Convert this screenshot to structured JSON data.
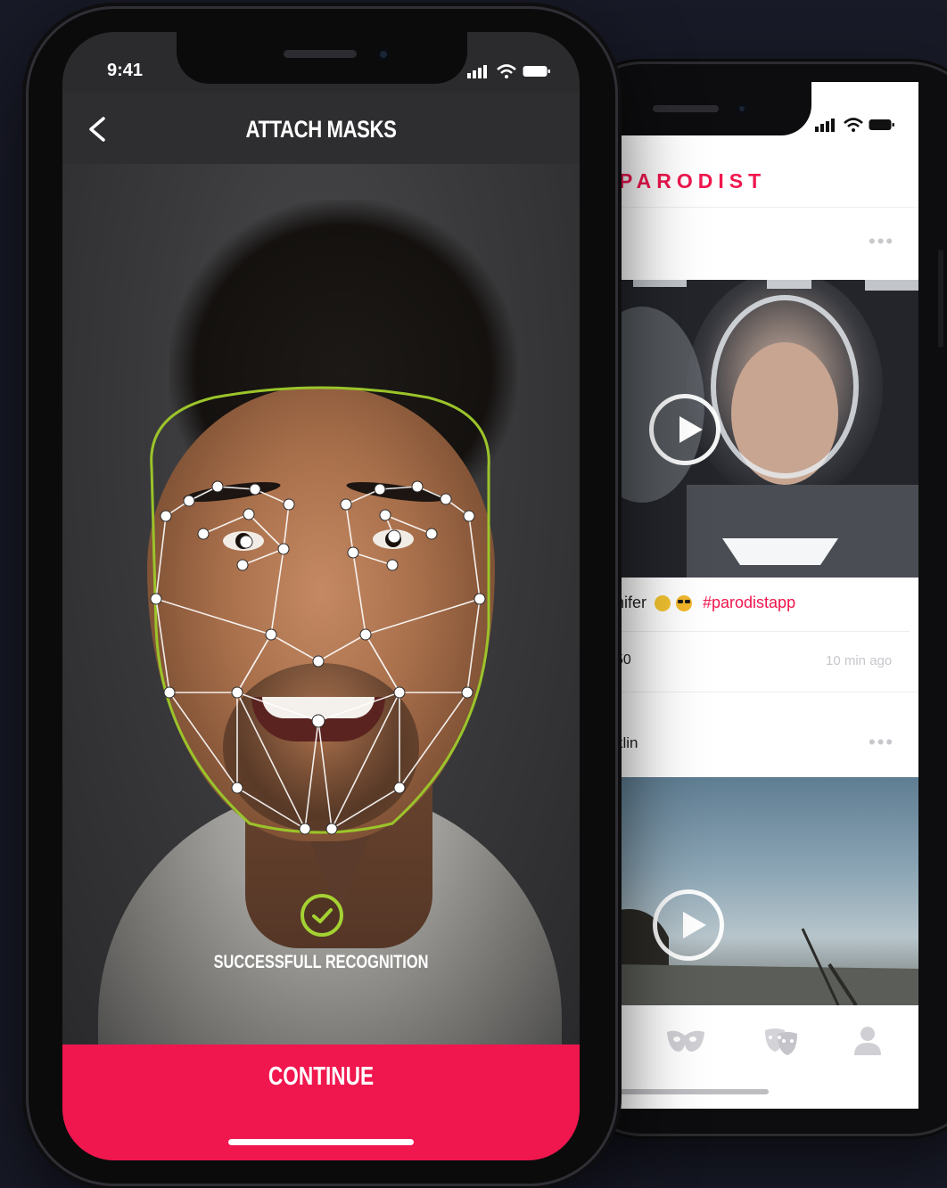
{
  "front_phone": {
    "status_bar": {
      "time": "9:41"
    },
    "header": {
      "title": "ATTACH MASKS"
    },
    "recognition": {
      "status_text": "SUCCESSFULL RECOGNITION",
      "icon": "check-circle-icon"
    },
    "cta": {
      "label": "CONTINUE"
    }
  },
  "back_phone": {
    "app_name": "PARODIST",
    "feed": [
      {
        "caption_name": "nifer",
        "caption_emojis": [
          "tongue-face-emoji",
          "sunglasses-face-emoji"
        ],
        "caption_hashtag": "#parodistapp",
        "comment_user": "50",
        "time_ago": "10 min ago"
      },
      {
        "user_name": "klin"
      }
    ],
    "tab_icons": [
      "masks-icon",
      "theater-masks-icon",
      "profile-icon"
    ]
  },
  "colors": {
    "accent": "#f0164e",
    "success_green": "#a4d233",
    "background": "#181a27"
  }
}
